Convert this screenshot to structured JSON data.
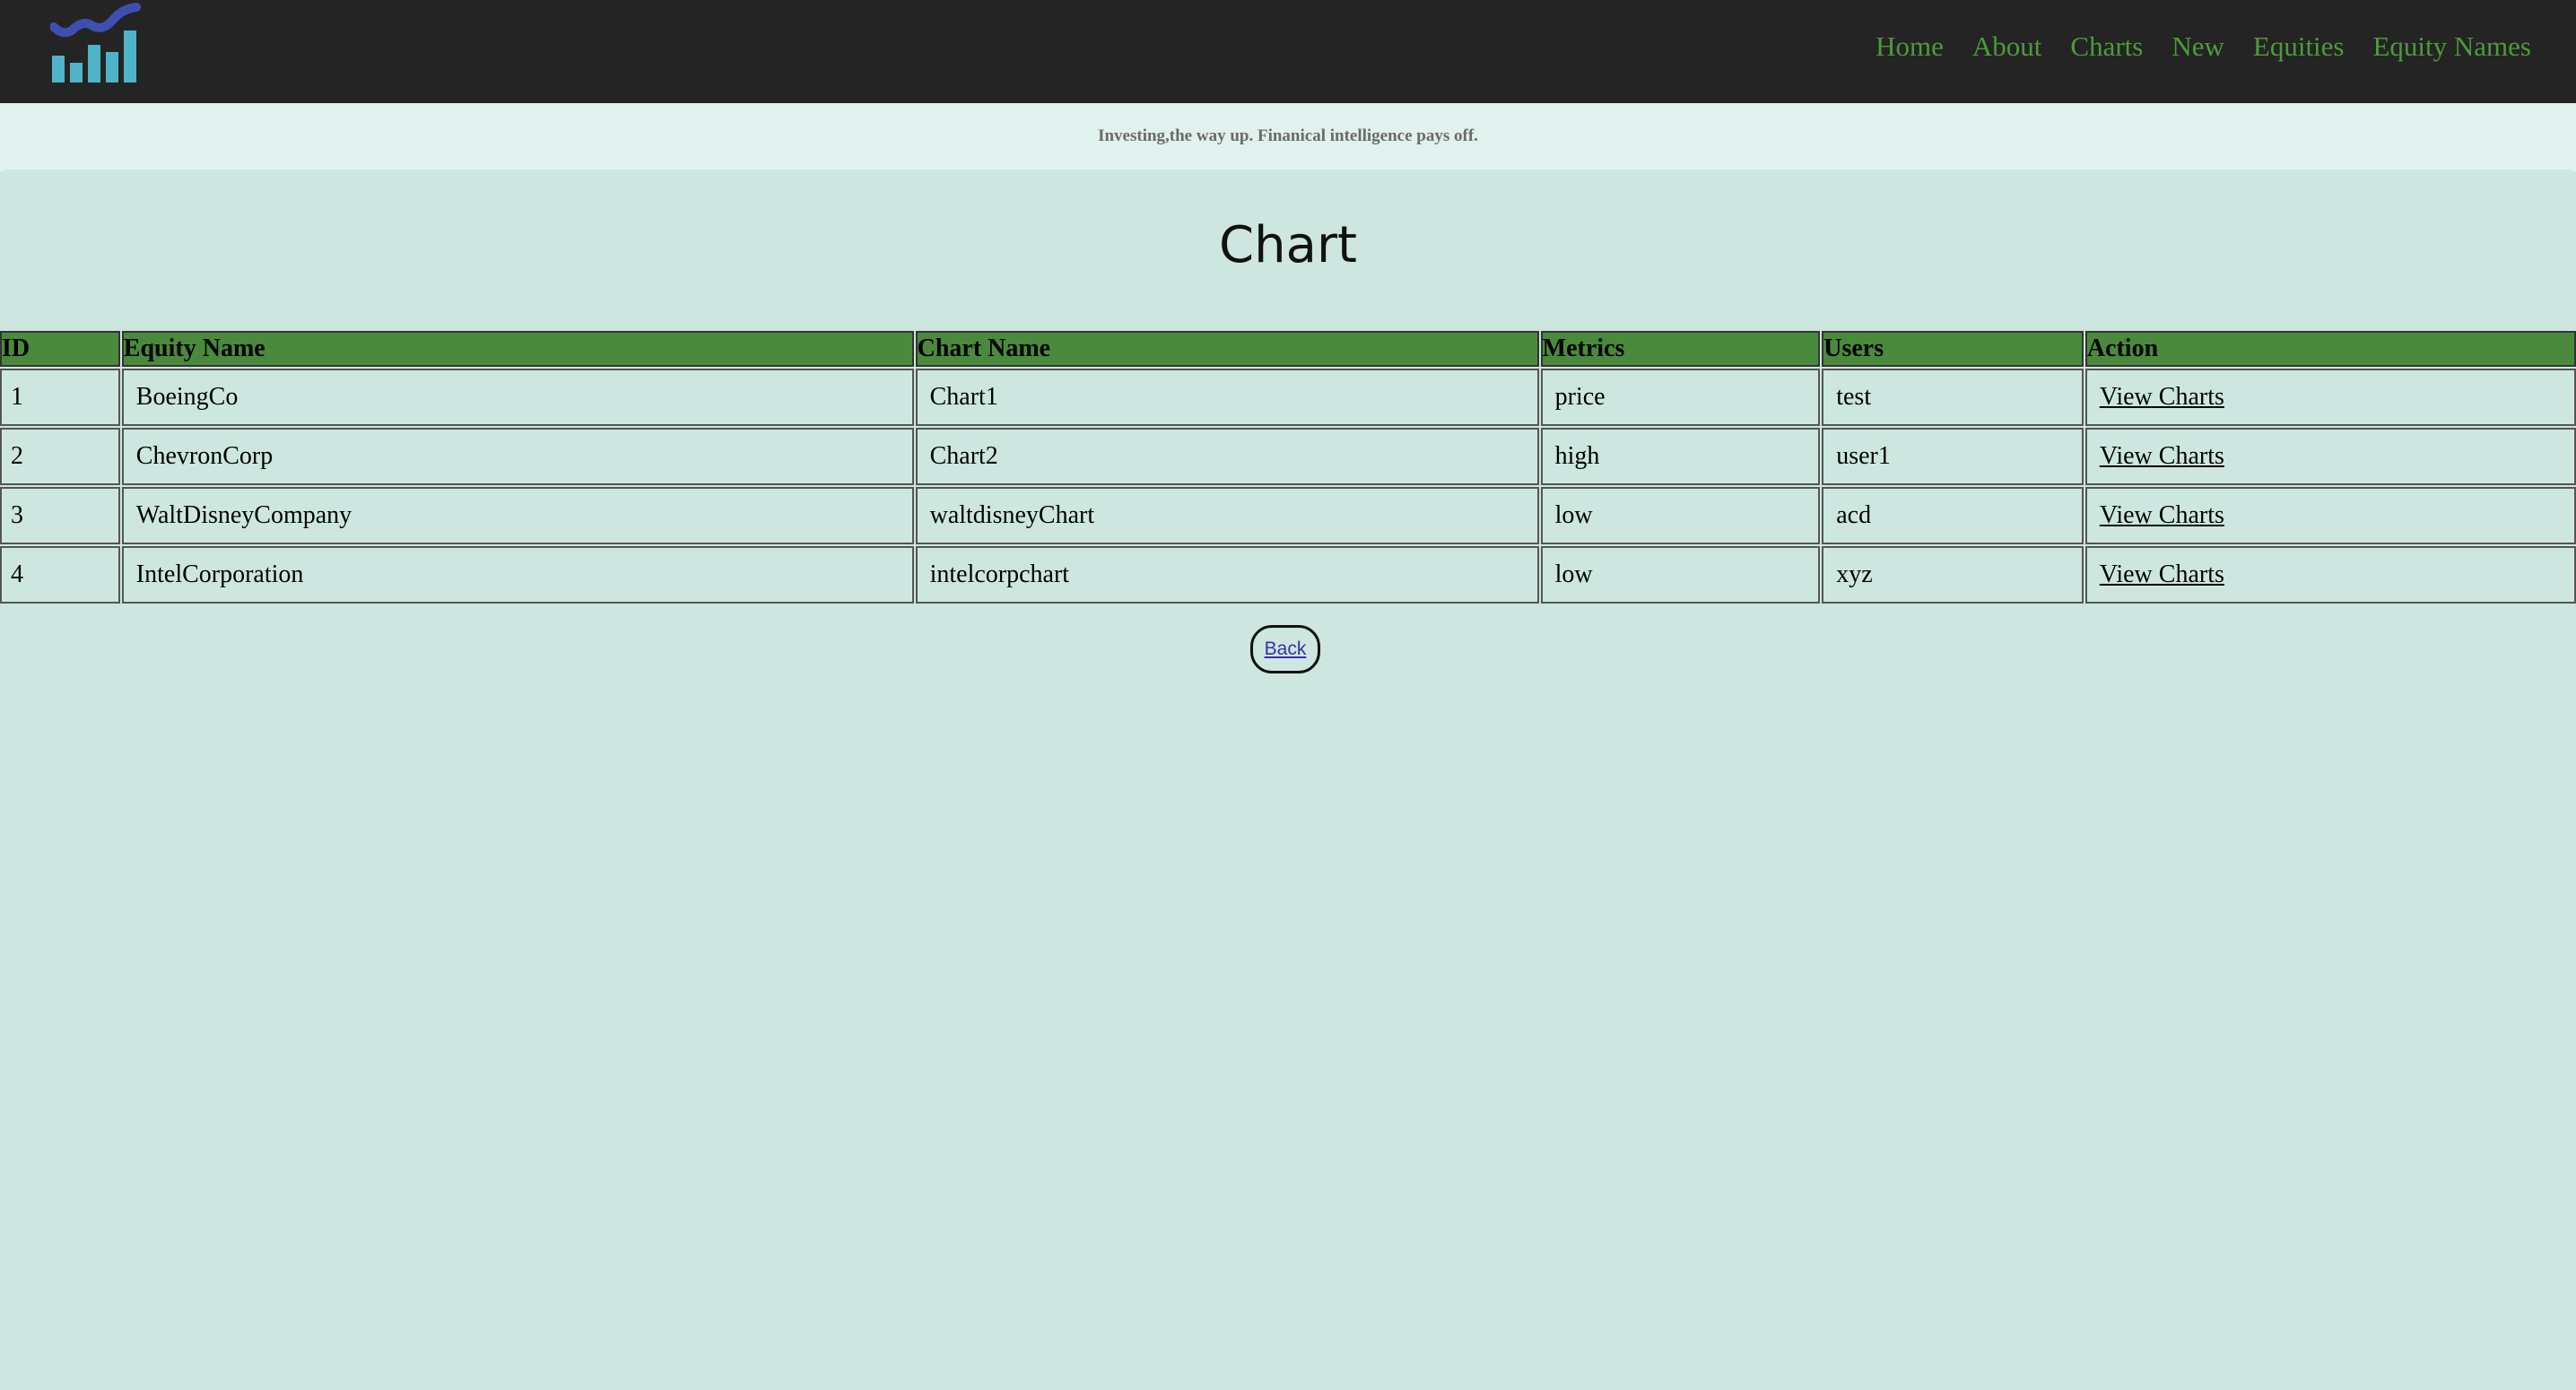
{
  "nav": {
    "logo_icon": "bar-chart-trend-logo-icon",
    "links": [
      "Home",
      "About",
      "Charts",
      "New",
      "Equities",
      "Equity Names"
    ],
    "link_color": "#4d9a3c"
  },
  "tagline": "Investing,the way up. Finanical intelligence pays off.",
  "page_title": "Chart",
  "table": {
    "headers": [
      "ID",
      "Equity Name",
      "Chart Name",
      "Metrics",
      "Users",
      "Action"
    ],
    "rows": [
      {
        "id": "1",
        "equity_name": "BoeingCo",
        "chart_name": "Chart1",
        "metrics": "price",
        "users": "test",
        "action": "View Charts"
      },
      {
        "id": "2",
        "equity_name": "ChevronCorp",
        "chart_name": "Chart2",
        "metrics": "high",
        "users": "user1",
        "action": "View Charts"
      },
      {
        "id": "3",
        "equity_name": "WaltDisneyCompany",
        "chart_name": "waltdisneyChart",
        "metrics": "low",
        "users": "acd",
        "action": "View Charts"
      },
      {
        "id": "4",
        "equity_name": "IntelCorporation",
        "chart_name": "intelcorpchart",
        "metrics": "low",
        "users": "xyz",
        "action": "View Charts"
      }
    ],
    "header_color": "#4b8a3d"
  },
  "back_button": "Back"
}
